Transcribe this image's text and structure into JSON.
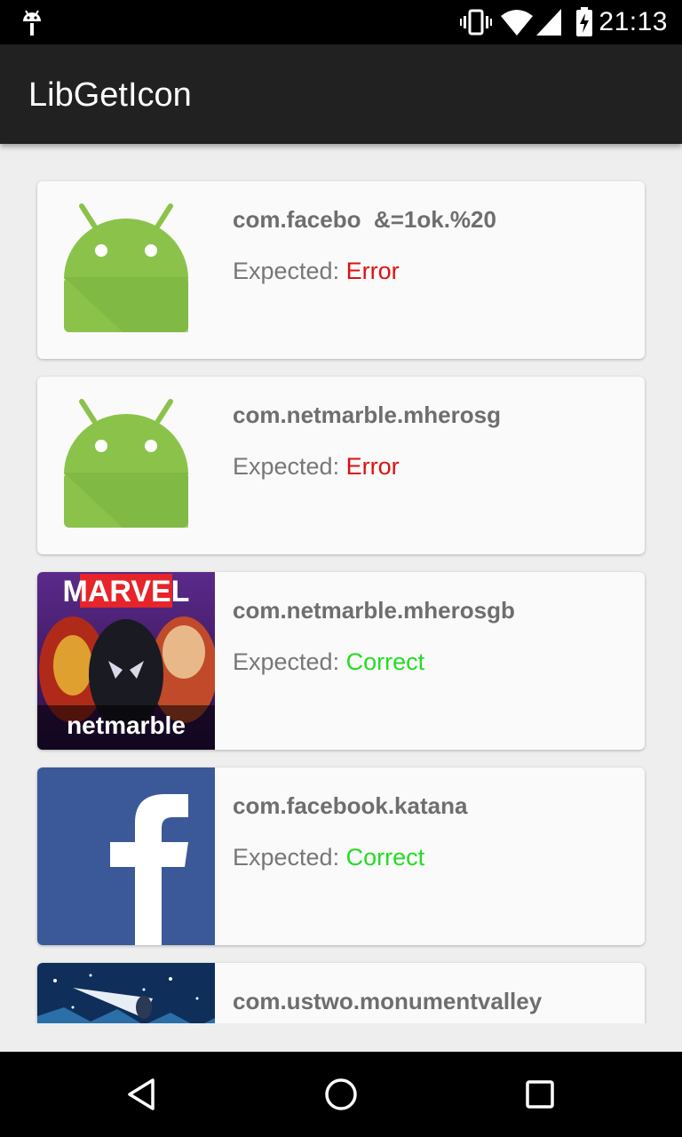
{
  "status_bar": {
    "time": "21:13",
    "icons": [
      "android-debug-icon",
      "vibrate-icon",
      "wifi-icon",
      "signal-icon",
      "battery-charging-icon"
    ]
  },
  "app_bar": {
    "title": "LibGetIcon"
  },
  "colors": {
    "correct": "#22dd22",
    "error": "#e01010",
    "app_bar": "#212121"
  },
  "items": [
    {
      "package": "com.facebo  &=1ok.%20",
      "expected_label": "Expected: ",
      "expected_value": "Error",
      "icon": "android-default-icon"
    },
    {
      "package": "com.netmarble.mherosg",
      "expected_label": "Expected: ",
      "expected_value": "Error",
      "icon": "android-default-icon"
    },
    {
      "package": "com.netmarble.mherosgb",
      "expected_label": "Expected: ",
      "expected_value": "Correct",
      "icon": "marvel-netmarble-icon",
      "icon_text_top": "MARVEL",
      "icon_text_bottom": "netmarble"
    },
    {
      "package": "com.facebook.katana",
      "expected_label": "Expected: ",
      "expected_value": "Correct",
      "icon": "facebook-icon"
    },
    {
      "package": "com.ustwo.monumentvalley",
      "icon": "monument-valley-icon"
    }
  ],
  "nav_bar": {
    "buttons": [
      "back-icon",
      "home-icon",
      "recents-icon"
    ]
  }
}
